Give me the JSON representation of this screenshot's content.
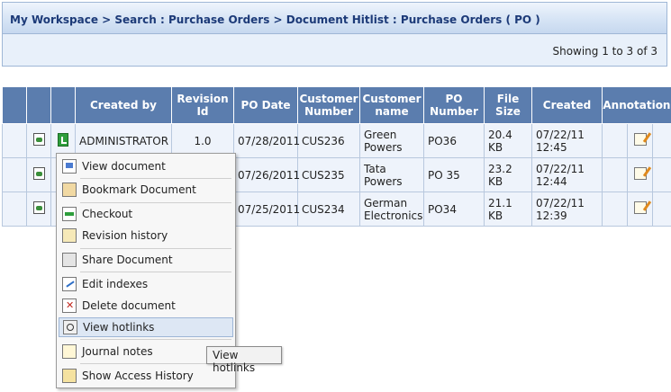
{
  "breadcrumb": "My Workspace > Search : Purchase Orders > Document Hitlist : Purchase Orders ( PO )",
  "showing": "Showing 1 to 3 of 3",
  "columns": {
    "created_by": "Created by",
    "revision_id": "Revision Id",
    "po_date": "PO Date",
    "customer_number": "Customer Number",
    "customer_name": "Customer name",
    "po_number": "PO Number",
    "file_size": "File Size",
    "created": "Created",
    "annotations": "Annotations"
  },
  "rows": [
    {
      "created_by": "ADMINISTRATOR",
      "revision_id": "1.0",
      "po_date": "07/28/2011",
      "customer_number": "CUS236",
      "customer_name": "Green Powers",
      "po_number": "PO36",
      "file_size": "20.4 KB",
      "created": "07/22/11 12:45"
    },
    {
      "created_by": "",
      "revision_id": "",
      "po_date": "07/26/2011",
      "customer_number": "CUS235",
      "customer_name": "Tata Powers",
      "po_number": "PO 35",
      "file_size": "23.2 KB",
      "created": "07/22/11 12:44"
    },
    {
      "created_by": "",
      "revision_id": "",
      "po_date": "07/25/2011",
      "customer_number": "CUS234",
      "customer_name": "German Electronics",
      "po_number": "PO34",
      "file_size": "21.1 KB",
      "created": "07/22/11 12:39"
    }
  ],
  "context_menu": {
    "items": [
      {
        "label": "View document",
        "icon": "view-document-icon"
      },
      {
        "label": "Bookmark Document",
        "icon": "bookmark-icon"
      },
      {
        "label": "Checkout",
        "icon": "checkout-icon"
      },
      {
        "label": "Revision history",
        "icon": "revision-history-icon"
      },
      {
        "label": "Share Document",
        "icon": "share-icon"
      },
      {
        "label": "Edit indexes",
        "icon": "edit-indexes-icon"
      },
      {
        "label": "Delete document",
        "icon": "delete-icon"
      },
      {
        "label": "View hotlinks",
        "icon": "hotlinks-icon"
      },
      {
        "label": "Journal notes",
        "icon": "journal-notes-icon"
      },
      {
        "label": "Show Access History",
        "icon": "access-history-icon"
      }
    ],
    "selected": "View hotlinks"
  },
  "tooltip": "View hotlinks",
  "colors": {
    "header": "#5b7dae",
    "row": "#eef3fb",
    "breadcrumb_text": "#1c3a78"
  }
}
